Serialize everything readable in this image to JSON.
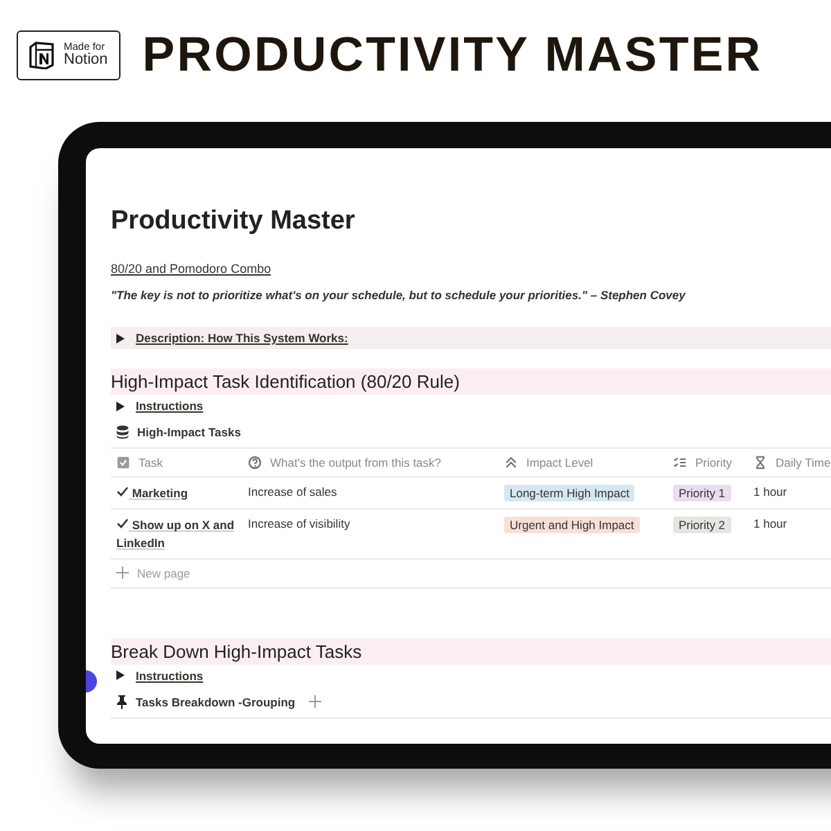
{
  "badge": {
    "line_1": "Made for",
    "line_2": "Notion"
  },
  "banner_title": "PRODUCTIVITY MASTER",
  "page": {
    "title": "Productivity Master",
    "subtitle": "80/20 and Pomodoro Combo",
    "quote": "\"The key is not to prioritize what's on your schedule, but to schedule your priorities.\" – Stephen Covey",
    "description_toggle": {
      "label": "Description: How This System Works:",
      "expanded": false
    },
    "sections": [
      {
        "heading": "High-Impact Task Identification (80/20 Rule)",
        "toggle": {
          "label": "Instructions",
          "expanded": false
        },
        "database": {
          "kind": "table",
          "title": "High-Impact Tasks",
          "columns": [
            "Task",
            "What's the output from this task?",
            "Impact Level",
            "Priority",
            "Daily Time"
          ],
          "rows": [
            {
              "task": "Marketing",
              "output": "Increase of sales",
              "impact": {
                "label": "Long-term High Impact",
                "color": "#d5e8f1"
              },
              "priority": {
                "label": "Priority 1",
                "color": "#e9ddf0"
              },
              "time": "1 hour"
            },
            {
              "task": "Show up on X and LinkedIn",
              "output": "Increase of visibility",
              "impact": {
                "label": "Urgent and High Impact",
                "color": "#f6e0d6"
              },
              "priority": {
                "label": "Priority 2",
                "color": "#e6e5e2"
              },
              "time": "1 hour"
            }
          ],
          "new_row": "New page"
        }
      },
      {
        "heading": "Break Down High-Impact Tasks",
        "toggle": {
          "label": "Instructions",
          "expanded": false
        },
        "database": {
          "kind": "board",
          "title": "Tasks Breakdown -Grouping"
        }
      }
    ]
  }
}
